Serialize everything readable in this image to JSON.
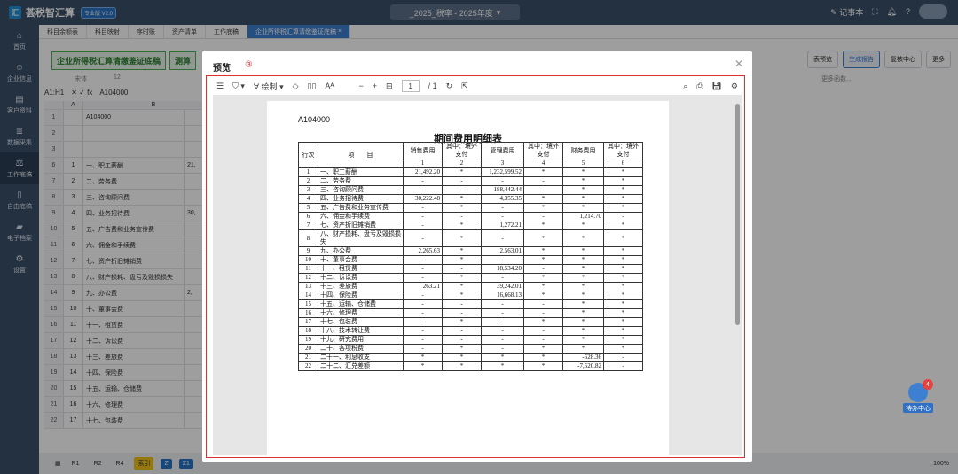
{
  "app": {
    "title": "荟税智汇算",
    "version": "专业版 V2.0",
    "center_title": "_2025_税率 - 2025年度",
    "right": [
      "记事本"
    ]
  },
  "sidebar": {
    "items": [
      "首页",
      "企业信息",
      "客户资料",
      "数据采集",
      "工作底稿",
      "自由底稿",
      "电子档案",
      "设置"
    ]
  },
  "tabs": [
    "科目余额表",
    "科目映射",
    "序时账",
    "资产清单",
    "工作底稿",
    "企业所得税汇算清缴鉴证底稿"
  ],
  "sheet": {
    "buttons": [
      "企业所得税汇算清缴鉴证底稿",
      "测算"
    ],
    "font": "宋体",
    "size": "12",
    "cell_ref": "A1:H1",
    "formula": "A104000",
    "right_buttons": [
      "表预览",
      "生成报告",
      "复核中心",
      "更多"
    ],
    "more_fn": "更多函数..."
  },
  "grid": {
    "col_headers": [
      "A",
      "B"
    ],
    "rows": [
      {
        "n": "1",
        "seq": "",
        "name": "A104000",
        "val": ""
      },
      {
        "n": "2",
        "seq": "",
        "name": "",
        "val": ""
      },
      {
        "n": "3",
        "seq": "",
        "name": "",
        "val": ""
      },
      {
        "n": "6",
        "seq": "1",
        "name": "一、职工薪酬",
        "val": "21,"
      },
      {
        "n": "7",
        "seq": "2",
        "name": "二、劳务费",
        "val": ""
      },
      {
        "n": "8",
        "seq": "3",
        "name": "三、咨询顾问费",
        "val": ""
      },
      {
        "n": "9",
        "seq": "4",
        "name": "四、业务招待费",
        "val": "30,"
      },
      {
        "n": "10",
        "seq": "5",
        "name": "五、广告费和业务宣传费",
        "val": ""
      },
      {
        "n": "11",
        "seq": "6",
        "name": "六、佣金和手续费",
        "val": ""
      },
      {
        "n": "12",
        "seq": "7",
        "name": "七、资产折旧摊销费",
        "val": ""
      },
      {
        "n": "13",
        "seq": "8",
        "name": "八、财产损耗、盘亏及毁损损失",
        "val": ""
      },
      {
        "n": "14",
        "seq": "9",
        "name": "九、办公费",
        "val": "2,"
      },
      {
        "n": "15",
        "seq": "10",
        "name": "十、董事会费",
        "val": ""
      },
      {
        "n": "16",
        "seq": "11",
        "name": "十一、租赁费",
        "val": ""
      },
      {
        "n": "17",
        "seq": "12",
        "name": "十二、诉讼费",
        "val": ""
      },
      {
        "n": "18",
        "seq": "13",
        "name": "十三、差旅费",
        "val": ""
      },
      {
        "n": "19",
        "seq": "14",
        "name": "十四、保险费",
        "val": ""
      },
      {
        "n": "20",
        "seq": "15",
        "name": "十五、运输、仓储费",
        "val": ""
      },
      {
        "n": "21",
        "seq": "16",
        "name": "十六、修理费",
        "val": ""
      },
      {
        "n": "22",
        "seq": "17",
        "name": "十七、包装费",
        "val": ""
      }
    ],
    "header_seq": "行次",
    "header_name": "项　　目",
    "header_val": "销"
  },
  "bottom": {
    "chips": [
      "R1",
      "R2",
      "R4",
      "索引",
      "Z",
      "Z1"
    ],
    "zoom": "100%"
  },
  "modal": {
    "title": "预览",
    "marker": "③",
    "page": "1",
    "pages": "/ 1",
    "draw": "绘制"
  },
  "doc": {
    "code": "A104000",
    "title": "期间费用明细表",
    "headers": [
      "行次",
      "项　　目",
      "销售费用",
      "其中：境外支付",
      "管理费用",
      "其中：境外支付",
      "财务费用",
      "其中：境外支付"
    ],
    "colnums": [
      "1",
      "2",
      "3",
      "4",
      "5",
      "6"
    ],
    "rows": [
      [
        "1",
        "一、职工薪酬",
        "21,492.20",
        "*",
        "1,232,599.52",
        "*",
        "*",
        "*"
      ],
      [
        "2",
        "二、劳务费",
        "-",
        "-",
        "-",
        "-",
        "*",
        "*"
      ],
      [
        "3",
        "三、咨询顾问费",
        "-",
        "-",
        "188,442.44",
        "-",
        "*",
        "*"
      ],
      [
        "4",
        "四、业务招待费",
        "30,222.48",
        "*",
        "4,355.35",
        "*",
        "*",
        "*"
      ],
      [
        "5",
        "五、广告费和业务宣传费",
        "-",
        "*",
        "-",
        "*",
        "*",
        "*"
      ],
      [
        "6",
        "六、佣金和手续费",
        "-",
        "-",
        "-",
        "-",
        "1,214.70",
        "-"
      ],
      [
        "7",
        "七、资产折旧摊销费",
        "-",
        "*",
        "1,272.21",
        "*",
        "*",
        "*"
      ],
      [
        "8",
        "八、财产损耗、盘亏及毁损损失",
        "-",
        "*",
        "-",
        "*",
        "*",
        "*"
      ],
      [
        "9",
        "九、办公费",
        "2,265.63",
        "*",
        "2,563.01",
        "*",
        "*",
        "*"
      ],
      [
        "10",
        "十、董事会费",
        "-",
        "*",
        "-",
        "*",
        "*",
        "*"
      ],
      [
        "11",
        "十一、租赁费",
        "-",
        "-",
        "18,534.20",
        "-",
        "*",
        "*"
      ],
      [
        "12",
        "十二、诉讼费",
        "-",
        "*",
        "-",
        "*",
        "*",
        "*"
      ],
      [
        "13",
        "十三、差旅费",
        "263.21",
        "*",
        "39,242.01",
        "*",
        "*",
        "*"
      ],
      [
        "14",
        "十四、保险费",
        "-",
        "*",
        "16,668.13",
        "*",
        "*",
        "*"
      ],
      [
        "15",
        "十五、运输、仓储费",
        "-",
        "-",
        "-",
        "-",
        "*",
        "*"
      ],
      [
        "16",
        "十六、修理费",
        "-",
        "-",
        "-",
        "-",
        "*",
        "*"
      ],
      [
        "17",
        "十七、包装费",
        "-",
        "*",
        "-",
        "*",
        "*",
        "*"
      ],
      [
        "18",
        "十八、技术转让费",
        "-",
        "-",
        "-",
        "-",
        "*",
        "*"
      ],
      [
        "19",
        "十九、研究费用",
        "-",
        "-",
        "-",
        "-",
        "*",
        "*"
      ],
      [
        "20",
        "二十、各项税费",
        "-",
        "*",
        "-",
        "*",
        "*",
        "*"
      ],
      [
        "21",
        "二十一、利息收支",
        "*",
        "*",
        "*",
        "*",
        "-528.36",
        "-"
      ],
      [
        "22",
        "二十二、汇兑差额",
        "*",
        "*",
        "*",
        "*",
        "-7,520.82",
        "-"
      ]
    ]
  },
  "helper": {
    "label": "待办中心",
    "count": "4"
  }
}
